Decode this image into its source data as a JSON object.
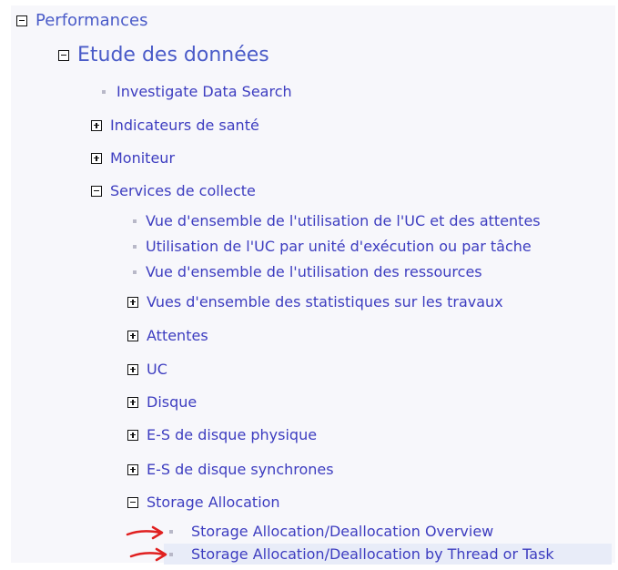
{
  "tree": {
    "performances": "Performances",
    "etude": "Etude des données",
    "investigate": "Investigate Data Search",
    "indicateurs": "Indicateurs de santé",
    "moniteur": "Moniteur",
    "services": "Services de collecte",
    "vue_uc": "Vue d'ensemble de l'utilisation de l'UC et des attentes",
    "util_uc": "Utilisation de l'UC par unité d'exécution ou par tâche",
    "vue_ressources": "Vue d'ensemble de l'utilisation des ressources",
    "vues_stats": "Vues d'ensemble des statistiques sur les travaux",
    "attentes": "Attentes",
    "uc": "UC",
    "disque": "Disque",
    "es_physique": "E-S de disque physique",
    "es_synchrones": "E-S de disque synchrones",
    "storage_alloc": "Storage Allocation",
    "storage_overview": "Storage Allocation/Deallocation Overview",
    "storage_thread": "Storage Allocation/Deallocation by Thread or Task"
  },
  "colors": {
    "link": "#3d3dc0",
    "annotation_arrow": "#e02020",
    "selected_row": "#e8ecf8"
  },
  "icons": {
    "expanded": "minus-box-icon",
    "collapsed": "plus-box-icon",
    "leaf": "bullet-icon"
  }
}
